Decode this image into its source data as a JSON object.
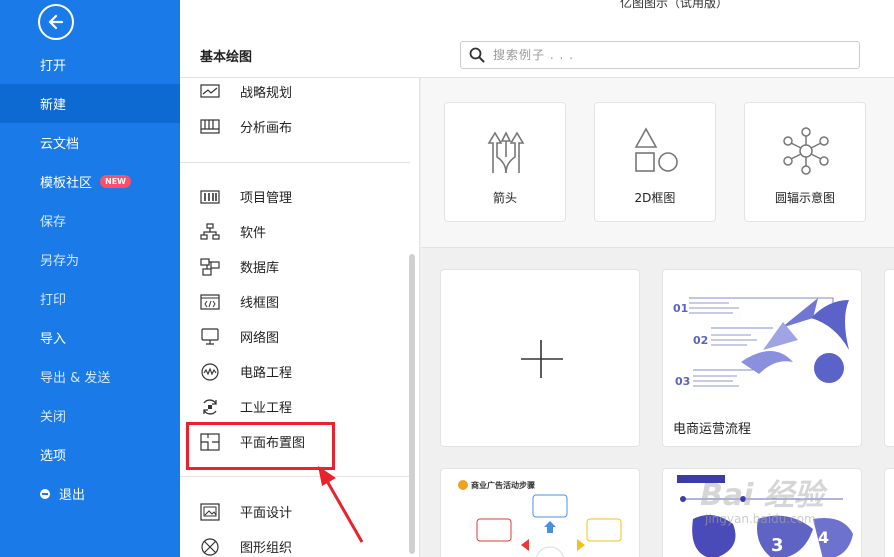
{
  "app": {
    "title": "亿图图示（试用版）"
  },
  "sidebar": {
    "items": [
      {
        "label": "打开"
      },
      {
        "label": "新建"
      },
      {
        "label": "云文档"
      },
      {
        "label": "模板社区",
        "badge": "NEW"
      },
      {
        "label": "保存"
      },
      {
        "label": "另存为"
      },
      {
        "label": "打印"
      },
      {
        "label": "导入"
      },
      {
        "label": "导出 & 发送"
      },
      {
        "label": "关闭"
      },
      {
        "label": "选项"
      },
      {
        "label": "退出"
      }
    ],
    "accent": "#1a7be8"
  },
  "header": {
    "section_title": "基本绘图",
    "search_placeholder": "搜索例子 . . ."
  },
  "categories": [
    {
      "label": "战略规划",
      "icon": "strategy-chart-icon"
    },
    {
      "label": "分析画布",
      "icon": "canvas-grid-icon"
    },
    {
      "label": "项目管理",
      "icon": "gantt-icon"
    },
    {
      "label": "软件",
      "icon": "org-tree-icon"
    },
    {
      "label": "数据库",
      "icon": "database-schema-icon"
    },
    {
      "label": "线框图",
      "icon": "wireframe-code-icon"
    },
    {
      "label": "网络图",
      "icon": "network-monitor-icon"
    },
    {
      "label": "电路工程",
      "icon": "circuit-wave-icon"
    },
    {
      "label": "工业工程",
      "icon": "industrial-cycle-icon"
    },
    {
      "label": "平面布置图",
      "icon": "floor-plan-icon"
    },
    {
      "label": "平面设计",
      "icon": "image-design-icon"
    },
    {
      "label": "图形组织",
      "icon": "graphic-organizer-icon"
    }
  ],
  "quick_templates": [
    {
      "label": "箭头",
      "icon": "arrows-icon"
    },
    {
      "label": "2D框图",
      "icon": "shapes-2d-icon"
    },
    {
      "label": "圆辐示意图",
      "icon": "radial-diagram-icon"
    }
  ],
  "templates": [
    {
      "label": "",
      "kind": "blank"
    },
    {
      "label": "电商运营流程",
      "kind": "preview"
    }
  ],
  "template_previews": {
    "ecommerce": {
      "steps": [
        "01",
        "02",
        "03"
      ]
    },
    "ad_campaign": {
      "title": "商业广告活动步骤"
    },
    "third": {
      "numbers": [
        "3",
        "4"
      ]
    }
  },
  "watermark": {
    "brand": "Bai 经验",
    "sub": "jingyan.baidu.com"
  },
  "colors": {
    "highlight": "#e8232b",
    "template_purple": "#5b63c9"
  }
}
